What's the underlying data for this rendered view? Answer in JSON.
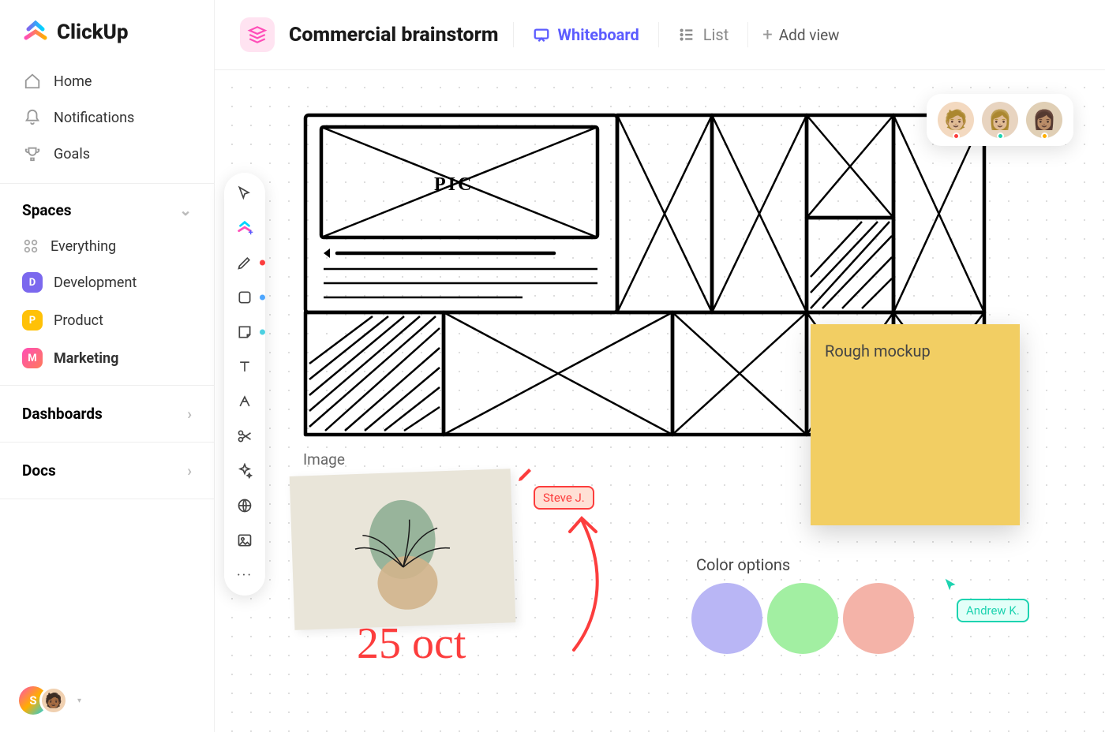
{
  "app": {
    "name": "ClickUp"
  },
  "nav": {
    "home": "Home",
    "notifications": "Notifications",
    "goals": "Goals"
  },
  "spaces": {
    "header": "Spaces",
    "everything": "Everything",
    "items": [
      {
        "letter": "D",
        "label": "Development"
      },
      {
        "letter": "P",
        "label": "Product"
      },
      {
        "letter": "M",
        "label": "Marketing",
        "active": true
      }
    ]
  },
  "sections": {
    "dashboards": "Dashboards",
    "docs": "Docs"
  },
  "header": {
    "title": "Commercial brainstorm",
    "views": {
      "whiteboard": "Whiteboard",
      "list": "List",
      "add": "Add view"
    }
  },
  "user_footer": {
    "letter": "S"
  },
  "canvas": {
    "wireframe_label": "PIC",
    "sticky": "Rough mockup",
    "image_label": "Image",
    "color_label": "Color options",
    "freehand_date": "25 oct",
    "swatches": [
      "#b9b6f5",
      "#a2efa2",
      "#f4b3a8"
    ]
  },
  "cursors": {
    "steve": "Steve J.",
    "andrew": "Andrew K."
  },
  "collaborators": [
    {
      "bg": "#f3d9c0",
      "status": "#fc3d3d"
    },
    {
      "bg": "#e8d4c0",
      "status": "#1dd3b0"
    },
    {
      "bg": "#e0cfb5",
      "status": "#ffae00"
    }
  ]
}
